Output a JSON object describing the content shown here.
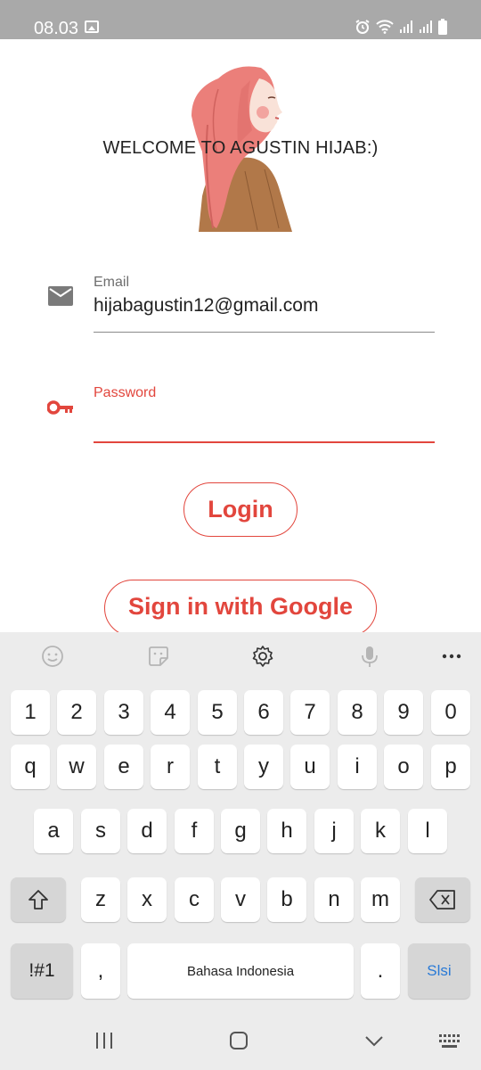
{
  "status_bar": {
    "time": "08.03"
  },
  "welcome": {
    "title": "WELCOME TO AGUSTIN HIJAB:)"
  },
  "email_field": {
    "label": "Email",
    "value": "hijabagustin12@gmail.com",
    "icon": "mail-icon"
  },
  "password_field": {
    "label": "Password",
    "value": "",
    "icon": "key-icon"
  },
  "buttons": {
    "login": "Login",
    "google": "Sign in with Google"
  },
  "keyboard": {
    "toolbar": [
      "emoji-icon",
      "sticker-icon",
      "settings-icon",
      "microphone-icon",
      "more-icon"
    ],
    "row_numbers": [
      "1",
      "2",
      "3",
      "4",
      "5",
      "6",
      "7",
      "8",
      "9",
      "0"
    ],
    "row1": [
      "q",
      "w",
      "e",
      "r",
      "t",
      "y",
      "u",
      "i",
      "o",
      "p"
    ],
    "row2": [
      "a",
      "s",
      "d",
      "f",
      "g",
      "h",
      "j",
      "k",
      "l"
    ],
    "row3": [
      "z",
      "x",
      "c",
      "v",
      "b",
      "n",
      "m"
    ],
    "symbols_key": "!#1",
    "comma_key": ",",
    "space_label": "Bahasa Indonesia",
    "period_key": ".",
    "send_key": "Slsi"
  },
  "colors": {
    "accent": "#e2463d",
    "status_bar": "#a9a9a9",
    "keyboard_bg": "#ececec",
    "send_key": "#2a7ad6"
  }
}
